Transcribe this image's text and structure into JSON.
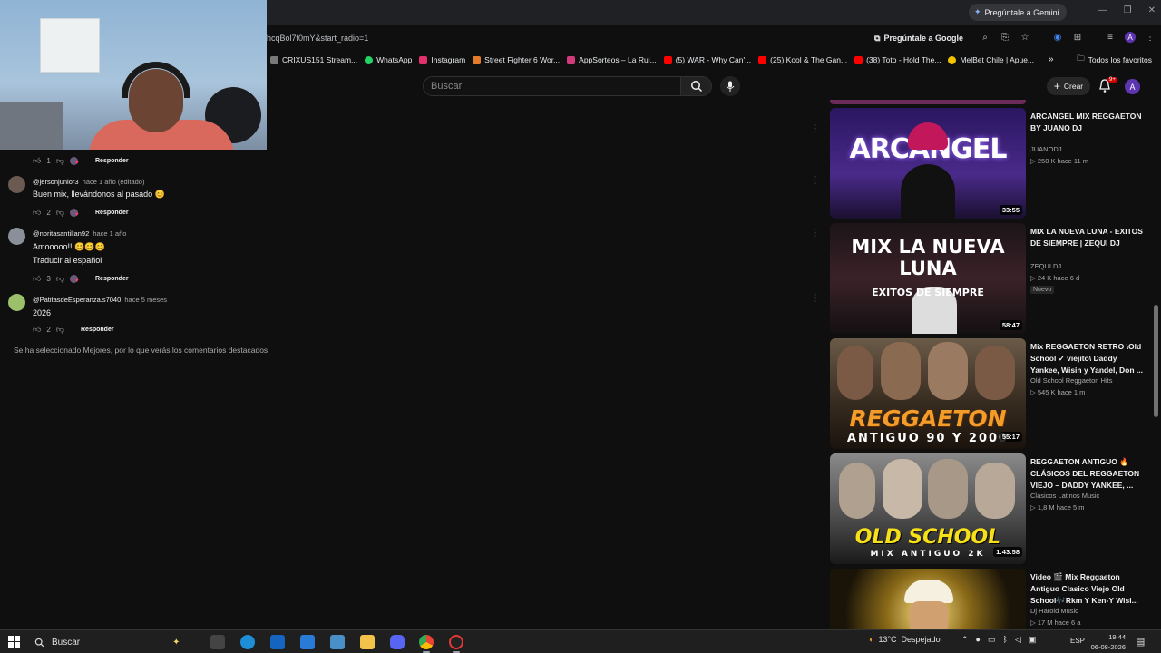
{
  "browser": {
    "gemini_chip": "Pregúntale a Gemini",
    "url_fragment": "hcqBol7f0mY&start_radio=1",
    "ask_google": "Pregúntale a Google",
    "bookmarks": [
      {
        "label": "CRIXUS151 Stream...",
        "color": "#7a7a7a"
      },
      {
        "label": "WhatsApp",
        "color": "#25d366"
      },
      {
        "label": "Instagram",
        "color": "#e1306c"
      },
      {
        "label": "Street Fighter 6 Wor...",
        "color": "#e37b2a"
      },
      {
        "label": "AppSorteos – La Rul...",
        "color": "#d23a7b"
      },
      {
        "label": "(5) WAR - Why Can'...",
        "color": "#ff0000"
      },
      {
        "label": "(25) Kool & The Gan...",
        "color": "#ff0000"
      },
      {
        "label": "(38) Toto - Hold The...",
        "color": "#ff0000"
      },
      {
        "label": "MelBet Chile | Apue...",
        "color": "#f2c200"
      }
    ],
    "all_bookmarks": "Todos los favoritos",
    "profile_letter": "A"
  },
  "youtube": {
    "search_placeholder": "Buscar",
    "create_label": "Crear",
    "notif_count": "9+",
    "account_letter": "A"
  },
  "comments": [
    {
      "likes": "1",
      "reply": "Responder"
    },
    {
      "author": "@jersonjunior3",
      "time": "hace 1 año (editado)",
      "text": "Buen mix, llevándonos al pasado 😊",
      "likes": "2",
      "reply": "Responder",
      "avatar_color": "#6b5a52"
    },
    {
      "author": "@noritasantillan92",
      "time": "hace 1 año",
      "text": "Amooooo!! 😊😊😊",
      "translate": "Traducir al español",
      "likes": "3",
      "reply": "Responder",
      "avatar_color": "#8a8f99"
    },
    {
      "author": "@PatitasdeEsperanza.s7040",
      "time": "hace 5 meses",
      "text": "2026",
      "likes": "2",
      "reply": "Responder",
      "avatar_color": "#9bbf6a"
    }
  ],
  "featured_note": "Se ha seleccionado Mejores, por lo que verás los comentarios destacados",
  "recommendations": [
    {
      "title": "ARCANGEL MIX REGGAETON BY JUANO DJ",
      "channel": "JUANODJ",
      "stats": "▷ 250 K  hace 11 m",
      "duration": "33:55",
      "thumb_text": "ARCANGEL",
      "thumb_bg": "#3a1f6e"
    },
    {
      "title": "MIX LA NUEVA LUNA - EXITOS DE SIEMPRE | ZEQUI DJ",
      "channel": "ZEQUI DJ",
      "stats": "▷ 24 K  hace 6 d",
      "badge": "Nuevo",
      "duration": "58:47",
      "thumb_text": "MIX LA NUEVA LUNA",
      "thumb_sub": "EXITOS DE SIEMPRE",
      "thumb_bg": "#2a1a1e"
    },
    {
      "title": "Mix REGGAETON RETRO \\Old School ✓ viejito\\ Daddy Yankee, Wisin y Yandel, Don ...",
      "channel": "Old School Reggaeton Hits",
      "stats": "▷ 545 K  hace 1 m",
      "duration": "55:17",
      "thumb_text": "REGGAETON",
      "thumb_sub": "ANTIGUO 90 Y 2000",
      "thumb_bg": "#4a3a2a"
    },
    {
      "title": "REGGAETON ANTIGUO 🔥 CLÁSICOS DEL REGGAETON VIEJO – DADDY YANKEE, ...",
      "channel": "Clásicos Latinos Music",
      "stats": "▷ 1,8 M  hace 5 m",
      "duration": "1:43:58",
      "thumb_text": "OLD SCHOOL",
      "thumb_sub": "MIX ANTIGUO 2K",
      "thumb_bg": "#5a5a5a"
    },
    {
      "title": "Video 🎬 Mix Reggaeton Antiguo Clasico Viejo Old School🎶Rkm Y Ken-Y Wisi...",
      "channel": "Dj Harold Music",
      "stats": "▷ 17 M  hace 6 a",
      "duration": "",
      "thumb_text": "",
      "thumb_bg": "#3a2e10"
    }
  ],
  "taskbar": {
    "search": "Buscar",
    "weather_temp": "13°C",
    "weather_text": "Despejado",
    "lang": "ESP",
    "time": "19:44",
    "date": "06-08-2026"
  }
}
